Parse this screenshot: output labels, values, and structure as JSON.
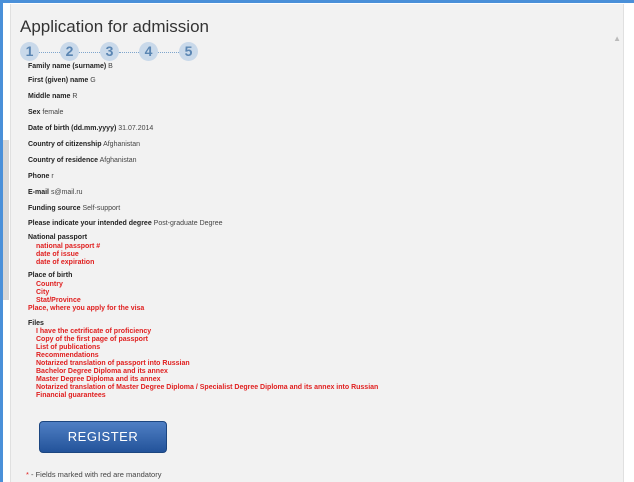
{
  "form": {
    "title": "Application for admission",
    "steps": [
      "1",
      "2",
      "3",
      "4",
      "5"
    ],
    "fields": [
      {
        "label": "Family name (surname)",
        "value": "B"
      },
      {
        "label": "First (given) name",
        "value": "G"
      },
      {
        "label": "Middle name",
        "value": "R"
      },
      {
        "label": "Sex",
        "value": "female"
      },
      {
        "label": "Date of birth (dd.mm.yyyy)",
        "value": "31.07.2014"
      },
      {
        "label": "Country of citizenship",
        "value": "Afghanistan"
      },
      {
        "label": "Country of residence",
        "value": "Afghanistan"
      },
      {
        "label": "Phone",
        "value": "r"
      },
      {
        "label": "E-mail",
        "value": "s@mail.ru"
      },
      {
        "label": "Funding source",
        "value": "Self-support"
      },
      {
        "label": "Please indicate your intended degree",
        "value": "Post-graduate Degree"
      }
    ],
    "passport": {
      "heading": "National passport",
      "items": [
        "national passport #",
        "date of issue",
        "date of expiration"
      ]
    },
    "birth": {
      "heading": "Place of birth",
      "items": [
        "Country",
        "City",
        "Stat/Province"
      ],
      "visa_place": "Place, where you apply for the visa"
    },
    "files": {
      "heading": "Files",
      "items": [
        "I have the cetrificate of proficiency",
        "Copy of the first page of passport",
        "List of publications",
        "Recommendations",
        "Notarized translation of passport into Russian",
        "Bachelor Degree Diploma and its annex",
        "Master Degree Diploma and its annex",
        "Notarized translation of Master Degree Diploma / Specialist Degree Diploma and its annex into Russian",
        "Financial guarantees"
      ]
    },
    "register_label": "REGISTER",
    "footnote_star": "*",
    "footnote": " - Fields marked with red are mandatory"
  },
  "colors": {
    "accent": "#2f5fa6",
    "required": "#e02020",
    "step": "#c9d9ea"
  }
}
